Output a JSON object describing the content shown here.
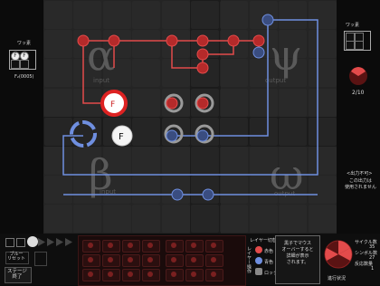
{
  "left_panel": {
    "title": "ワッ素",
    "formula": "F₂(0005)",
    "mini_cells": [
      "F",
      "F"
    ]
  },
  "right_panel": {
    "title": "ワッ素",
    "progress": "2/10",
    "no_output_heading": "<出力不可>",
    "no_output_text": "この出力は\n使用されません"
  },
  "quadrants": {
    "alpha": {
      "symbol": "α",
      "label": "input"
    },
    "psi": {
      "symbol": "ψ",
      "label": "output"
    },
    "beta": {
      "symbol": "β",
      "label": "input"
    },
    "omega": {
      "symbol": "ω",
      "label": "output"
    }
  },
  "board": {
    "atom_label": "F",
    "red_atom_label": "F"
  },
  "bottom": {
    "step_labels": [
      "■",
      "▶",
      "▶▶"
    ],
    "blue_button_label": "ブルー\nリセット",
    "stage_end_label": "ステージ\n終了",
    "layer_settings_label": "レイヤー切替",
    "layer_ops_label": "レイヤー操作",
    "legend": [
      "赤色",
      "青色",
      "ロック"
    ],
    "tooltip": "黒子でマウス\nオーバーすると\n詳細が表示\nされます。",
    "stats": {
      "cycles_label": "サイクル数",
      "cycles_value": "35",
      "symbols_label": "シンボル数",
      "symbols_value": "27",
      "reactors_label": "反応数量",
      "reactors_value": "1",
      "best_label": "進行状況"
    }
  },
  "colors": {
    "red": "#e34b4b",
    "blue": "#6f8fe0",
    "grey": "#9a9a9a"
  }
}
